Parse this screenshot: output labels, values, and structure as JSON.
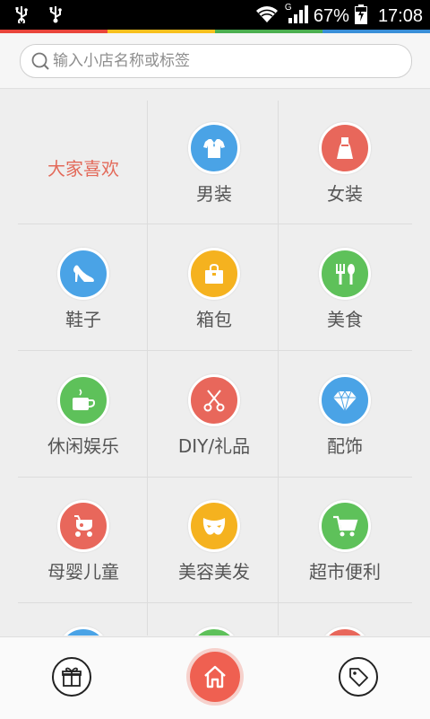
{
  "status_bar": {
    "battery": "67%",
    "time": "17:08",
    "network": "G"
  },
  "search": {
    "placeholder": "输入小店名称或标签"
  },
  "grid": {
    "favorite_label": "大家喜欢",
    "items": [
      {
        "label": "男装",
        "icon": "shirt-icon",
        "color": "#4aa3e6"
      },
      {
        "label": "女装",
        "icon": "dress-icon",
        "color": "#e8675b"
      },
      {
        "label": "鞋子",
        "icon": "high-heel-icon",
        "color": "#4aa3e6"
      },
      {
        "label": "箱包",
        "icon": "handbag-icon",
        "color": "#f5b21f"
      },
      {
        "label": "美食",
        "icon": "cutlery-icon",
        "color": "#5ec15a"
      },
      {
        "label": "休闲娱乐",
        "icon": "coffee-cup-icon",
        "color": "#5ec15a"
      },
      {
        "label": "DIY/礼品",
        "icon": "scissors-icon",
        "color": "#e8675b"
      },
      {
        "label": "配饰",
        "icon": "diamond-icon",
        "color": "#4aa3e6"
      },
      {
        "label": "母婴儿童",
        "icon": "stroller-icon",
        "color": "#e8675b"
      },
      {
        "label": "美容美发",
        "icon": "mask-icon",
        "color": "#f5b21f"
      },
      {
        "label": "超市便利",
        "icon": "shopping-cart-icon",
        "color": "#5ec15a"
      }
    ]
  },
  "bottom_nav": {
    "left_icon": "gift-icon",
    "center_icon": "home-icon",
    "right_icon": "tag-icon"
  },
  "colors": {
    "accent": "#ef6051",
    "favorite_text": "#e36a5a",
    "strip": [
      "#e9453b",
      "#f7c01e",
      "#4caf50",
      "#3a8fd8"
    ]
  }
}
